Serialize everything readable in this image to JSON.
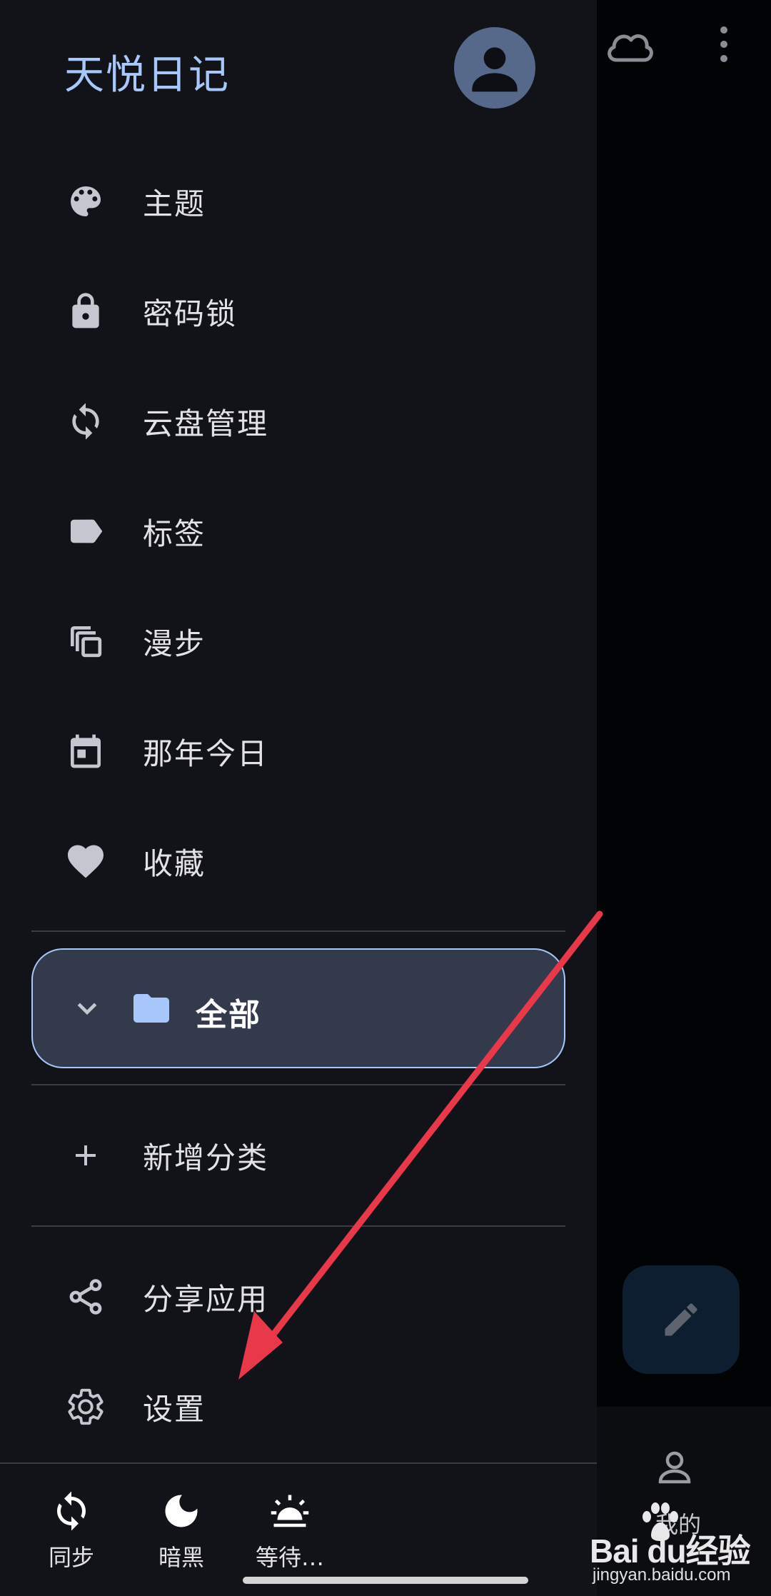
{
  "background_app": {
    "fab_icon": "pencil-icon",
    "bottom_nav_label": "我的"
  },
  "drawer": {
    "app_title": "天悦日记",
    "menu": [
      {
        "label": "主题",
        "icon": "palette-icon"
      },
      {
        "label": "密码锁",
        "icon": "lock-icon"
      },
      {
        "label": "云盘管理",
        "icon": "sync-icon"
      },
      {
        "label": "标签",
        "icon": "label-icon"
      },
      {
        "label": "漫步",
        "icon": "copy-stack-icon"
      },
      {
        "label": "那年今日",
        "icon": "calendar-icon"
      },
      {
        "label": "收藏",
        "icon": "heart-icon"
      }
    ],
    "folder": {
      "label": "全部",
      "icon": "folder-icon"
    },
    "add_category": "新增分类",
    "share_app": "分享应用",
    "settings": "设置",
    "bottom_bar": {
      "sync": "同步",
      "dark": "暗黑",
      "waiting": "等待…"
    }
  },
  "watermark": {
    "brand": "Bai du经验",
    "url": "jingyan.baidu.com"
  },
  "colors": {
    "accent": "#a8c7fa",
    "drawer_bg": "#111318",
    "annotation_arrow": "#e8384a"
  }
}
